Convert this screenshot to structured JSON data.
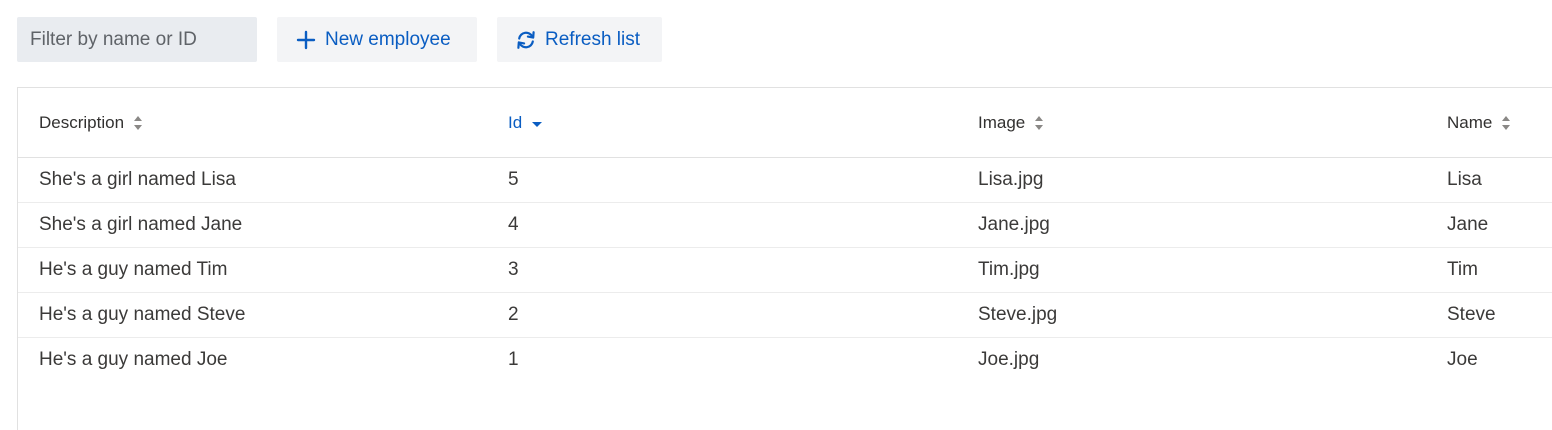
{
  "toolbar": {
    "search_placeholder": "Filter by name or ID",
    "new_button_label": "New employee",
    "refresh_button_label": "Refresh list"
  },
  "colors": {
    "accent": "#0a5dc2",
    "input_bg": "#e9ecf0",
    "button_bg": "#f3f4f6",
    "border": "#e1e1e1"
  },
  "table": {
    "columns": [
      {
        "label": "Description",
        "sort": "none"
      },
      {
        "label": "Id",
        "sort": "descending"
      },
      {
        "label": "Image",
        "sort": "none"
      },
      {
        "label": "Name",
        "sort": "none"
      }
    ],
    "rows": [
      {
        "description": "She's a girl named Lisa",
        "id": "5",
        "image": "Lisa.jpg",
        "name": "Lisa"
      },
      {
        "description": "She's a girl named Jane",
        "id": "4",
        "image": "Jane.jpg",
        "name": "Jane"
      },
      {
        "description": "He's a guy named Tim",
        "id": "3",
        "image": "Tim.jpg",
        "name": "Tim"
      },
      {
        "description": "He's a guy named Steve",
        "id": "2",
        "image": "Steve.jpg",
        "name": "Steve"
      },
      {
        "description": "He's a guy named Joe",
        "id": "1",
        "image": "Joe.jpg",
        "name": "Joe"
      }
    ]
  }
}
